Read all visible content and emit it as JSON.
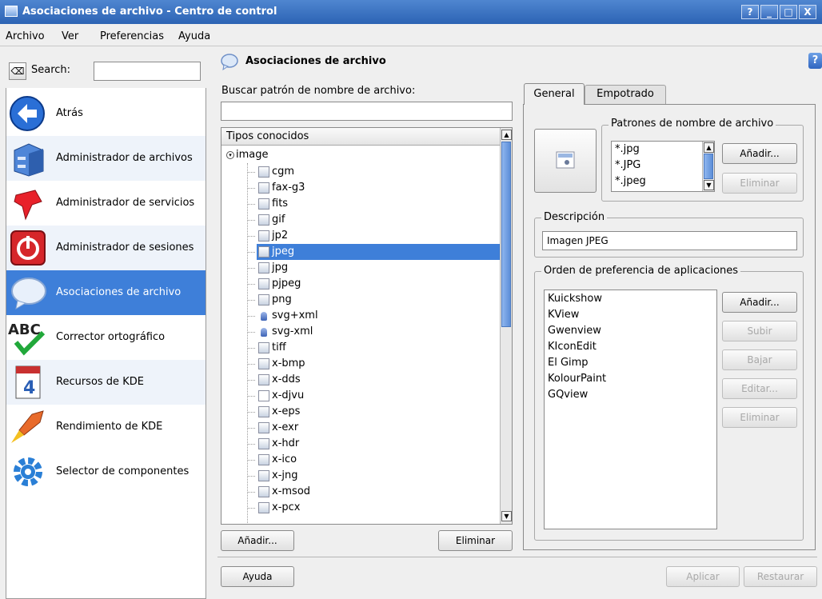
{
  "window": {
    "title": "Asociaciones de archivo - Centro de control",
    "buttons": [
      "?",
      "_",
      "□",
      "X"
    ]
  },
  "menu": [
    "Archivo",
    "Ver",
    "Preferencias",
    "Ayuda"
  ],
  "sidebar": {
    "search_label": "Search:",
    "search_value": "",
    "items": [
      {
        "label": "Atrás",
        "icon": "back-arrow-icon"
      },
      {
        "label": "Administrador de archivos",
        "icon": "file-cabinet-icon"
      },
      {
        "label": "Administrador de servicios",
        "icon": "services-pin-icon"
      },
      {
        "label": "Administrador de sesiones",
        "icon": "power-icon"
      },
      {
        "label": "Asociaciones de archivo",
        "icon": "speech-bubble-icon"
      },
      {
        "label": "Corrector ortográfico",
        "icon": "abc-check-icon"
      },
      {
        "label": "Recursos de KDE",
        "icon": "calendar-icon"
      },
      {
        "label": "Rendimiento de KDE",
        "icon": "rocket-icon"
      },
      {
        "label": "Selector de componentes",
        "icon": "gear-icon"
      }
    ]
  },
  "header": {
    "title": "Asociaciones de archivo",
    "help": "?"
  },
  "left_panel": {
    "search_label": "Buscar patrón de nombre de archivo:",
    "search_value": "",
    "tree_header": "Tipos conocidos",
    "root": "image",
    "items": [
      {
        "label": "cgm",
        "icon": "image"
      },
      {
        "label": "fax-g3",
        "icon": "image"
      },
      {
        "label": "fits",
        "icon": "image"
      },
      {
        "label": "gif",
        "icon": "image"
      },
      {
        "label": "jp2",
        "icon": "image"
      },
      {
        "label": "jpeg",
        "icon": "image"
      },
      {
        "label": "jpg",
        "icon": "image"
      },
      {
        "label": "pjpeg",
        "icon": "image"
      },
      {
        "label": "png",
        "icon": "image"
      },
      {
        "label": "svg+xml",
        "icon": "svg"
      },
      {
        "label": "svg-xml",
        "icon": "svg"
      },
      {
        "label": "tiff",
        "icon": "image"
      },
      {
        "label": "x-bmp",
        "icon": "image"
      },
      {
        "label": "x-dds",
        "icon": "image"
      },
      {
        "label": "x-djvu",
        "icon": "plain"
      },
      {
        "label": "x-eps",
        "icon": "image"
      },
      {
        "label": "x-exr",
        "icon": "image"
      },
      {
        "label": "x-hdr",
        "icon": "image"
      },
      {
        "label": "x-ico",
        "icon": "image"
      },
      {
        "label": "x-jng",
        "icon": "image"
      },
      {
        "label": "x-msod",
        "icon": "image"
      },
      {
        "label": "x-pcx",
        "icon": "image"
      }
    ],
    "selected": "jpeg",
    "add_button": "Añadir...",
    "remove_button": "Eliminar"
  },
  "tabs": [
    "General",
    "Empotrado"
  ],
  "general": {
    "patterns_title": "Patrones de nombre de archivo",
    "patterns": [
      "*.jpg",
      "*.JPG",
      "*.jpeg"
    ],
    "patterns_add": "Añadir...",
    "patterns_remove": "Eliminar",
    "description_title": "Descripción",
    "description_value": "Imagen JPEG",
    "apps_title": "Orden de preferencia de aplicaciones",
    "apps": [
      "Kuickshow",
      "KView",
      "Gwenview",
      "KIconEdit",
      "El Gimp",
      "KolourPaint",
      "GQview"
    ],
    "apps_add": "Añadir...",
    "apps_up": "Subir",
    "apps_down": "Bajar",
    "apps_edit": "Editar...",
    "apps_remove": "Eliminar"
  },
  "footer": {
    "help": "Ayuda",
    "apply": "Aplicar",
    "restore": "Restaurar"
  },
  "colors": {
    "titlebar": "#2c63b4",
    "selection": "#3e7fd9"
  }
}
